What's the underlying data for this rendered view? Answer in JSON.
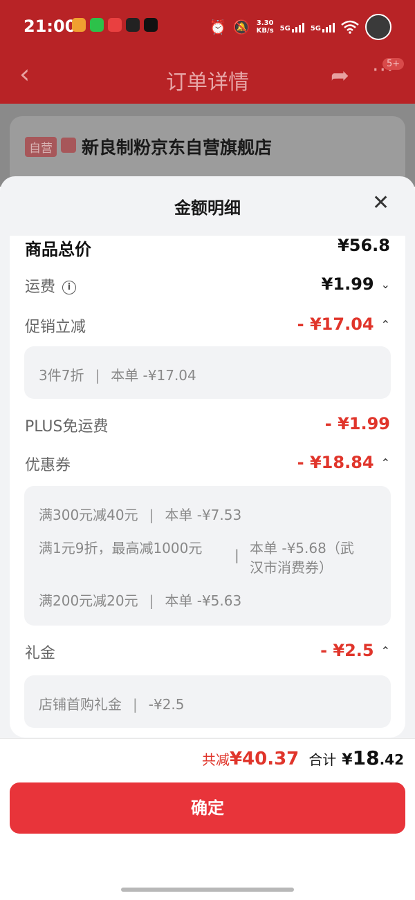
{
  "status_bar": {
    "time": "21:00",
    "net_speed": "3.30",
    "net_speed_unit": "KB/s",
    "network_1": "5G",
    "network_2": "5G"
  },
  "nav": {
    "title": "订单详情",
    "badge": "5+"
  },
  "store": {
    "tag": "自营",
    "name": "新良制粉京东自营旗舰店"
  },
  "sheet": {
    "title": "金额明细",
    "rows": {
      "total": {
        "label": "商品总价",
        "value": "¥56.8"
      },
      "shipping": {
        "label": "运费",
        "value": "¥1.99"
      },
      "promo": {
        "label": "促销立减",
        "value": "- ¥17.04",
        "detail": {
          "rule": "3件7折",
          "amount": "本单 -¥17.04"
        }
      },
      "plus": {
        "label": "PLUS免运费",
        "value": "- ¥1.99"
      },
      "coupon": {
        "label": "优惠券",
        "value": "- ¥18.84",
        "details": [
          {
            "rule": "满300元减40元",
            "amount": "本单 -¥7.53"
          },
          {
            "rule": "满1元9折，最高减1000元",
            "amount_line1": "本单 -¥5.68（武",
            "amount_line2": "汉市消费券）"
          },
          {
            "rule": "满200元减20元",
            "amount": "本单 -¥5.63"
          }
        ]
      },
      "gift": {
        "label": "礼金",
        "value": "- ¥2.5",
        "detail": {
          "rule": "店铺首购礼金",
          "amount": "-¥2.5"
        }
      }
    }
  },
  "footer": {
    "save_label": "共减",
    "save_value": "¥40.37",
    "sum_label": "合计",
    "sum_yen": "¥",
    "sum_int": "18",
    "sum_dec": ".42",
    "confirm_label": "确定"
  },
  "colors": {
    "accent_red": "#e0352b",
    "button_red": "#e8343a",
    "header_red": "#b82326"
  }
}
